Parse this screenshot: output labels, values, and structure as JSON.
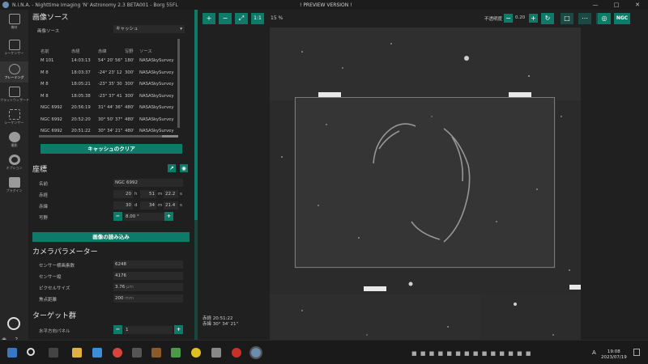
{
  "window": {
    "title": "N.I.N.A. - Nighttime Imaging 'N' Astronomy 2.3 BETA001  -  Borg 55FL",
    "center_title": "! PREVIEW VERSION !",
    "controls": [
      "—",
      "□",
      "✕"
    ]
  },
  "nav": {
    "items": [
      {
        "label": "機材"
      },
      {
        "label": "シーケンサー"
      },
      {
        "label": "フレーミング"
      },
      {
        "label": "フラットウィザード"
      },
      {
        "label": "シーケンサー"
      },
      {
        "label": "撮影"
      },
      {
        "label": "オプション"
      },
      {
        "label": "プラグイン"
      }
    ],
    "bottom": "◉ ? ⓘ",
    "collapse": "<<"
  },
  "image_source": {
    "header": "画像ソース",
    "label": "画像ソース",
    "selected": "キャッシュ",
    "columns": [
      "名前",
      "赤経",
      "赤緯",
      "写野",
      "ソース"
    ],
    "rows": [
      [
        "M 101",
        "14:03:13",
        "54° 20' 56\"",
        "180'",
        "NASASkySurvey"
      ],
      [
        "M 8",
        "18:03:37",
        "-24° 23' 12",
        "300'",
        "NASASkySurvey"
      ],
      [
        "M 8",
        "18:05:21",
        "-23° 35' 30",
        "300'",
        "NASASkySurvey"
      ],
      [
        "M 8",
        "18:05:38",
        "-23° 37' 41",
        "300'",
        "NASASkySurvey"
      ],
      [
        "NGC 6992",
        "20:56:19",
        "31° 44' 36\"",
        "480'",
        "NASASkySurvey"
      ],
      [
        "NGC 6992",
        "20:52:20",
        "30° 50' 37\"",
        "480'",
        "NASASkySurvey"
      ],
      [
        "NGC 6992",
        "20:51:22",
        "30° 34' 21\"",
        "480'",
        "NASASkySurvey"
      ]
    ],
    "clear_button": "キャッシュのクリア"
  },
  "coordinates": {
    "header": "座標",
    "name_label": "名前",
    "name_value": "NGC 6992",
    "ra_label": "赤経",
    "ra_h": "20",
    "ra_h_unit": "h",
    "ra_m": "51",
    "ra_m_unit": "m",
    "ra_s": "22.2",
    "ra_s_unit": "s",
    "dec_label": "赤緯",
    "dec_d": "30",
    "dec_d_unit": "d",
    "dec_m": "34",
    "dec_m_unit": "m",
    "dec_s": "21.4",
    "dec_s_unit": "s",
    "fov_label": "写野",
    "fov_value": "8.00",
    "fov_unit": "°",
    "load_button": "画像の読み込み"
  },
  "camera": {
    "header": "カメラパラメーター",
    "width_label": "センサー横画素数",
    "width_value": "6248",
    "height_label": "センサー縦",
    "height_value": "4176",
    "pixel_label": "ピクセルサイズ",
    "pixel_value": "3.76",
    "pixel_unit": "μm",
    "focal_label": "焦点距離",
    "focal_value": "200",
    "focal_unit": "mm"
  },
  "target_group": {
    "header": "ターゲット群",
    "panels_label": "水平方向パネル",
    "panels_value": "1"
  },
  "toolbar": {
    "zoom_in": "+",
    "zoom_out": "−",
    "fit": "⤢",
    "one_to_one": "1:1",
    "zoom_pct": "15 %",
    "opacity_label": "不透明度",
    "opacity_value": "0.20",
    "ngc": "NGC"
  },
  "preview": {
    "ra_readout": "赤経  20:51:22",
    "dec_readout": "赤緯  30° 34' 21\""
  },
  "taskbar": {
    "time": "19:08",
    "date": "2023/07/19",
    "ime": "A"
  },
  "colors": {
    "accent": "#0e7a68",
    "background": "#1e1e1e"
  }
}
